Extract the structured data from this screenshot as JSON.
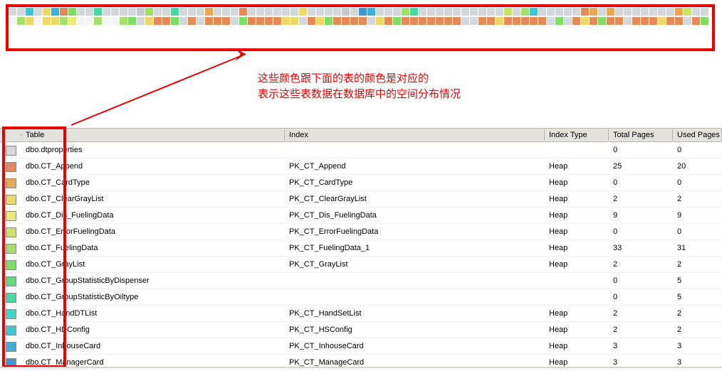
{
  "annotation": {
    "line1": "这些颜色跟下面的表的颜色是对应的",
    "line2": "表示这些表数据在数据库中的空间分布情况"
  },
  "columns": {
    "table": "Table",
    "index": "Index",
    "index_type": "Index Type",
    "total_pages": "Total Pages",
    "used_pages": "Used Pages"
  },
  "rows": [
    {
      "color": "#d4d7dc",
      "table": "dbo.dtproperties",
      "index": "",
      "index_type": "",
      "total_pages": "0",
      "used_pages": "0"
    },
    {
      "color": "#e48a59",
      "table": "dbo.CT_Append",
      "index": "PK_CT_Append",
      "index_type": "Heap",
      "total_pages": "25",
      "used_pages": "20"
    },
    {
      "color": "#e8a955",
      "table": "dbo.CT_CardType",
      "index": "PK_CT_CardType",
      "index_type": "Heap",
      "total_pages": "0",
      "used_pages": "0"
    },
    {
      "color": "#ead968",
      "table": "dbo.CT_ClearGrayList",
      "index": "PK_CT_ClearGrayList",
      "index_type": "Heap",
      "total_pages": "2",
      "used_pages": "2"
    },
    {
      "color": "#eaea7a",
      "table": "dbo.CT_Dis_FuelingData",
      "index": "PK_CT_Dis_FuelingData",
      "index_type": "Heap",
      "total_pages": "9",
      "used_pages": "9"
    },
    {
      "color": "#c8e36a",
      "table": "dbo.CT_ErrorFuelingData",
      "index": "PK_CT_ErrorFuelingData",
      "index_type": "Heap",
      "total_pages": "0",
      "used_pages": "0"
    },
    {
      "color": "#a3e06b",
      "table": "dbo.CT_FuelingData",
      "index": "PK_CT_FuelingData_1",
      "index_type": "Heap",
      "total_pages": "33",
      "used_pages": "31"
    },
    {
      "color": "#7edc6b",
      "table": "dbo.CT_GrayList",
      "index": "PK_CT_GrayList",
      "index_type": "Heap",
      "total_pages": "2",
      "used_pages": "2"
    },
    {
      "color": "#62d97e",
      "table": "dbo.CT_GroupStatisticByDispenser",
      "index": "",
      "index_type": "",
      "total_pages": "0",
      "used_pages": "5"
    },
    {
      "color": "#48d8a1",
      "table": "dbo.CT_GroupStatisticByOiltype",
      "index": "",
      "index_type": "",
      "total_pages": "0",
      "used_pages": "5"
    },
    {
      "color": "#3fd4c7",
      "table": "dbo.CT_HandDTList",
      "index": "PK_CT_HandSetList",
      "index_type": "Heap",
      "total_pages": "2",
      "used_pages": "2"
    },
    {
      "color": "#3fc7d6",
      "table": "dbo.CT_HDConfig",
      "index": "PK_CT_HSConfig",
      "index_type": "Heap",
      "total_pages": "2",
      "used_pages": "2"
    },
    {
      "color": "#3fb0d6",
      "table": "dbo.CT_InhouseCard",
      "index": "PK_CT_InhouseCard",
      "index_type": "Heap",
      "total_pages": "3",
      "used_pages": "3"
    },
    {
      "color": "#3f95d6",
      "table": "dbo.CT_ManagerCard",
      "index": "PK_CT_ManageCard",
      "index_type": "Heap",
      "total_pages": "3",
      "used_pages": "3"
    }
  ],
  "heatmap_palette": [
    "#e8eaec",
    "#d4d7dc",
    "#c6c9cf",
    "#e48a59",
    "#e8a955",
    "#ead968",
    "#eaea7a",
    "#c8e36a",
    "#a3e06b",
    "#7edc6b",
    "#62d97e",
    "#48d8a1",
    "#3fd4c7",
    "#3fc7d6",
    "#3fb0d6",
    "#3f95d6",
    "#f07060",
    "#f0a050"
  ]
}
